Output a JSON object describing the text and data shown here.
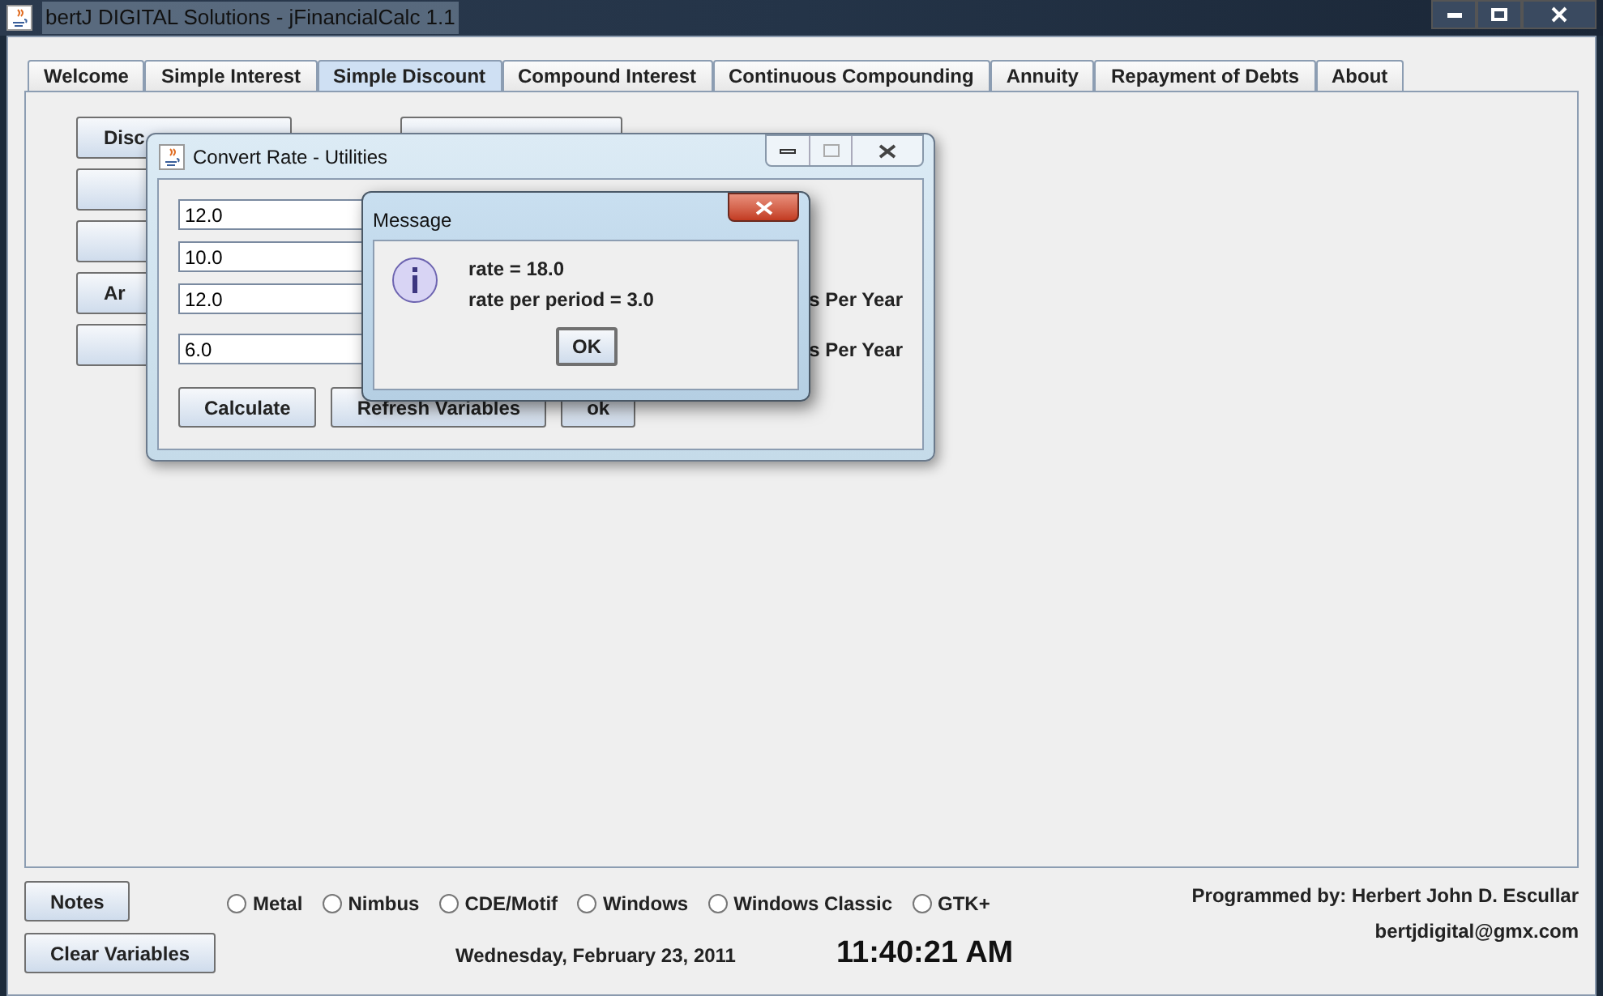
{
  "window": {
    "title": "bertJ DIGITAL Solutions - jFinancialCalc 1.1"
  },
  "tabs": [
    {
      "label": "Welcome",
      "selected": false
    },
    {
      "label": "Simple Interest",
      "selected": false
    },
    {
      "label": "Simple Discount",
      "selected": true
    },
    {
      "label": "Compound Interest",
      "selected": false
    },
    {
      "label": "Continuous Compounding",
      "selected": false
    },
    {
      "label": "Annuity",
      "selected": false
    },
    {
      "label": "Repayment of Debts",
      "selected": false
    },
    {
      "label": "About",
      "selected": false
    }
  ],
  "background_buttons": [
    {
      "label": "Disc"
    },
    {
      "label": "Ar"
    }
  ],
  "convert_dialog": {
    "title": "Convert Rate - Utilities",
    "rows": [
      {
        "value": "12.0"
      },
      {
        "value": "10.0"
      },
      {
        "value": "12.0",
        "label": "s Per Year"
      },
      {
        "value": "6.0",
        "label": "s Per Year"
      }
    ],
    "buttons": [
      "Calculate",
      "Refresh Variables",
      "ok"
    ]
  },
  "message_dialog": {
    "title": "Message",
    "lines": [
      "rate = 18.0",
      "rate per period = 3.0"
    ],
    "button": "OK"
  },
  "bottom": {
    "buttons": [
      "Notes",
      "Clear Variables"
    ],
    "look_and_feel": [
      {
        "label": "Metal",
        "selected": false
      },
      {
        "label": "Nimbus",
        "selected": false
      },
      {
        "label": "CDE/Motif",
        "selected": false
      },
      {
        "label": "Windows",
        "selected": false
      },
      {
        "label": "Windows Classic",
        "selected": false
      },
      {
        "label": "GTK+",
        "selected": false
      }
    ],
    "date": "Wednesday, February 23, 2011",
    "time": "11:40:21 AM",
    "credit": "Programmed by: Herbert John D. Escullar",
    "email": "bertjdigital@gmx.com"
  }
}
